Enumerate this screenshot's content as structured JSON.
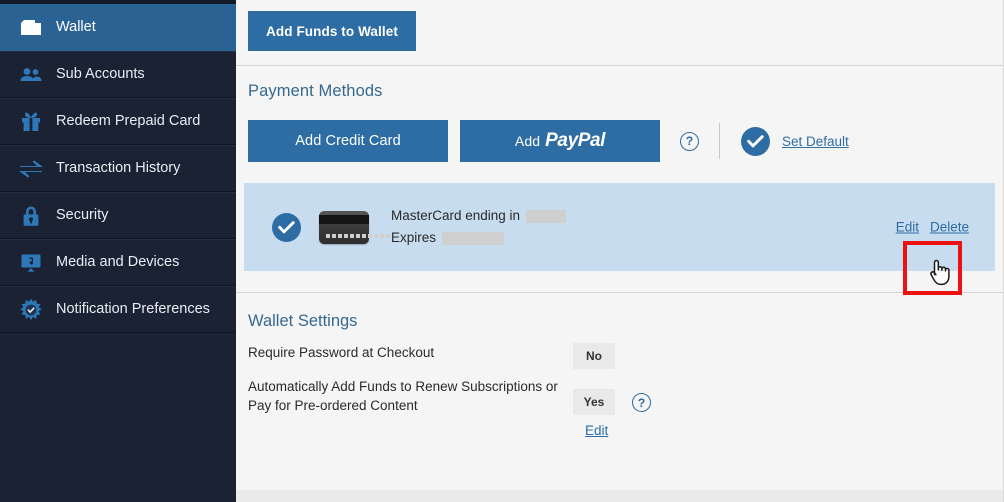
{
  "sidebar": {
    "items": [
      {
        "label": "Wallet",
        "icon": "wallet-icon",
        "active": true
      },
      {
        "label": "Sub Accounts",
        "icon": "users-icon",
        "active": false
      },
      {
        "label": "Redeem Prepaid Card",
        "icon": "gift-icon",
        "active": false
      },
      {
        "label": "Transaction History",
        "icon": "exchange-arrows-icon",
        "active": false
      },
      {
        "label": "Security",
        "icon": "lock-icon",
        "active": false
      },
      {
        "label": "Media and Devices",
        "icon": "media-device-icon",
        "active": false
      },
      {
        "label": "Notification Preferences",
        "icon": "burst-check-icon",
        "active": false
      }
    ]
  },
  "toolbar": {
    "add_funds_label": "Add Funds to Wallet"
  },
  "payment_methods": {
    "title": "Payment Methods",
    "add_credit_card_label": "Add Credit Card",
    "add_paypal_prefix": "Add",
    "add_paypal_logo": "PayPal",
    "help_glyph": "?",
    "set_default_label": "Set Default",
    "card": {
      "description_prefix": "MasterCard ending in",
      "expires_prefix": "Expires",
      "digits_redacted": "",
      "expiry_redacted": "",
      "edit_label": "Edit",
      "delete_label": "Delete"
    }
  },
  "wallet_settings": {
    "title": "Wallet Settings",
    "rows": [
      {
        "label": "Require Password at Checkout",
        "value": "No",
        "has_help": false
      },
      {
        "label": "Automatically Add Funds to Renew Subscriptions or Pay for Pre-ordered Content",
        "value": "Yes",
        "has_help": true,
        "help_glyph": "?"
      }
    ],
    "edit_label": "Edit"
  },
  "colors": {
    "sidebar_bg": "#1a2233",
    "sidebar_active": "#2b6294",
    "accent_blue": "#2d6da4",
    "heading_blue": "#36698f",
    "card_row_bg": "#c7dcee",
    "highlight_red": "#ee1111",
    "page_bg": "#f5f5f5"
  }
}
